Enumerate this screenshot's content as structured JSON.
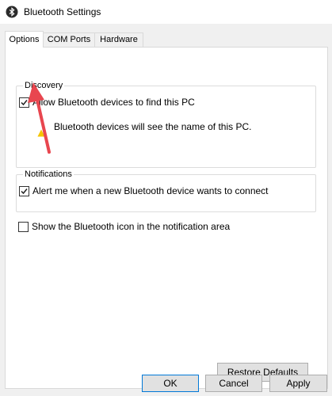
{
  "window": {
    "title": "Bluetooth Settings",
    "icon": "bluetooth-icon"
  },
  "tabs": [
    {
      "label": "Options",
      "active": true
    },
    {
      "label": "COM Ports",
      "active": false
    },
    {
      "label": "Hardware",
      "active": false
    }
  ],
  "discovery": {
    "title": "Discovery",
    "allow_label": "Allow Bluetooth devices to find this PC",
    "allow_checked": true,
    "note": "Bluetooth devices will see the name of this PC."
  },
  "notifications": {
    "title": "Notifications",
    "alert_label": "Alert me when a new Bluetooth device wants to connect",
    "alert_checked": true
  },
  "show_icon": {
    "label": "Show the Bluetooth icon in the notification area",
    "checked": false
  },
  "buttons": {
    "restore_defaults": "Restore Defaults",
    "ok": "OK",
    "cancel": "Cancel",
    "apply": "Apply"
  },
  "colors": {
    "annotation_arrow": "#e8464f",
    "warning": "#f5c400"
  }
}
